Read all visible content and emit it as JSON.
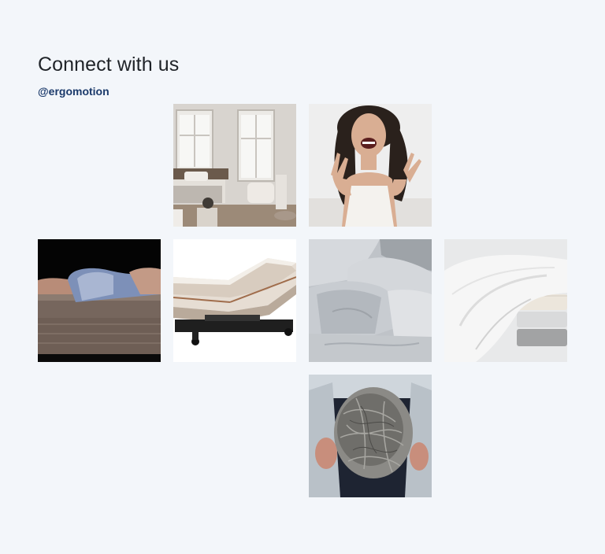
{
  "section": {
    "title": "Connect with us",
    "handle": "@ergomotion"
  },
  "gallery": [
    {
      "id": "bedroom-photo"
    },
    {
      "id": "smiling-woman-photo"
    },
    {
      "id": "mattress-sleeper-photo"
    },
    {
      "id": "adjustable-bed-photo"
    },
    {
      "id": "pillows-duvet-photo"
    },
    {
      "id": "folded-sheets-photo"
    },
    {
      "id": "wool-fiber-photo"
    }
  ]
}
